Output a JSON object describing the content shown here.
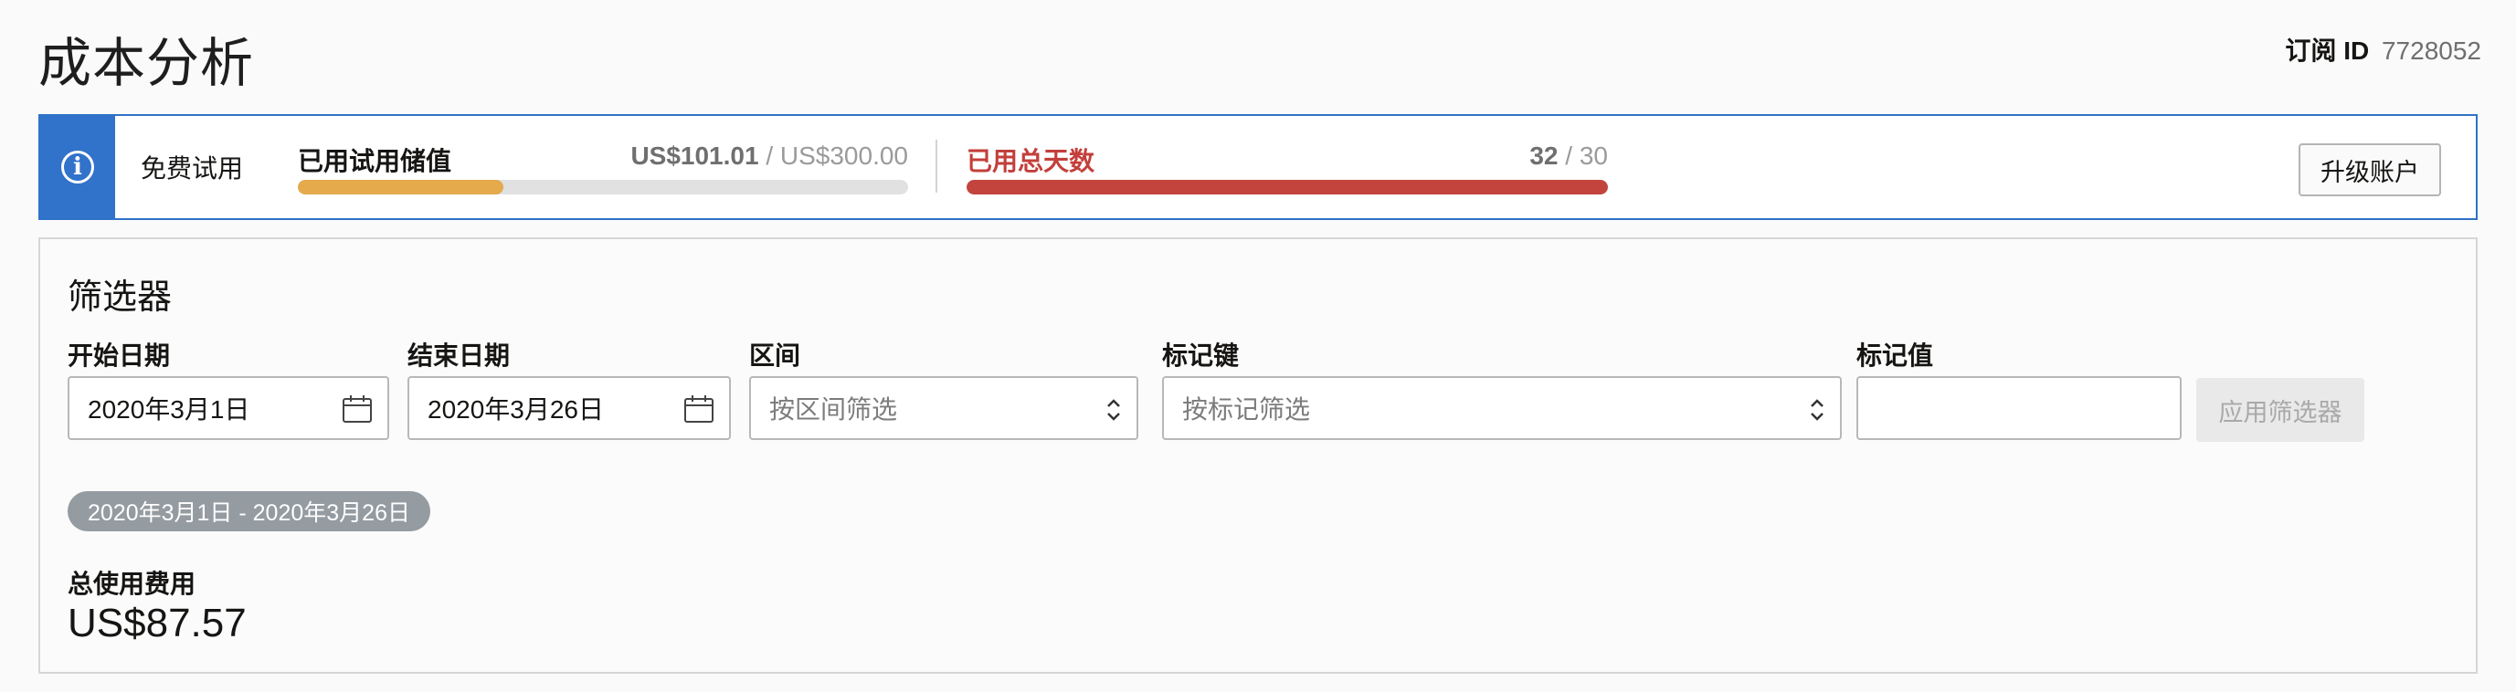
{
  "page": {
    "title": "成本分析"
  },
  "subscription": {
    "label": "订阅 ID",
    "value": "7728052"
  },
  "trial_banner": {
    "status": "免费试用",
    "credits": {
      "title": "已用试用储值",
      "used": "US$101.01",
      "separator": " / ",
      "total": "US$300.00",
      "fraction_used": 0.337
    },
    "days": {
      "title": "已用总天数",
      "used": "32",
      "separator": " / ",
      "total": "30",
      "fraction_used": 1.0
    },
    "upgrade_label": "升级账户",
    "colors": {
      "credits_fill": "#e4aa4b",
      "days_fill": "#c3443d",
      "accent": "#3172cb"
    }
  },
  "filters": {
    "title": "筛选器",
    "start_date": {
      "label": "开始日期",
      "value": "2020年3月1日"
    },
    "end_date": {
      "label": "结束日期",
      "value": "2020年3月26日"
    },
    "region": {
      "label": "区间",
      "placeholder": "按区间筛选"
    },
    "tag_key": {
      "label": "标记键",
      "placeholder": "按标记筛选"
    },
    "tag_value": {
      "label": "标记值",
      "value": ""
    },
    "apply_label": "应用筛选器"
  },
  "summary": {
    "range_badge": "2020年3月1日 - 2020年3月26日",
    "total_label": "总使用费用",
    "total_value": "US$87.57"
  }
}
